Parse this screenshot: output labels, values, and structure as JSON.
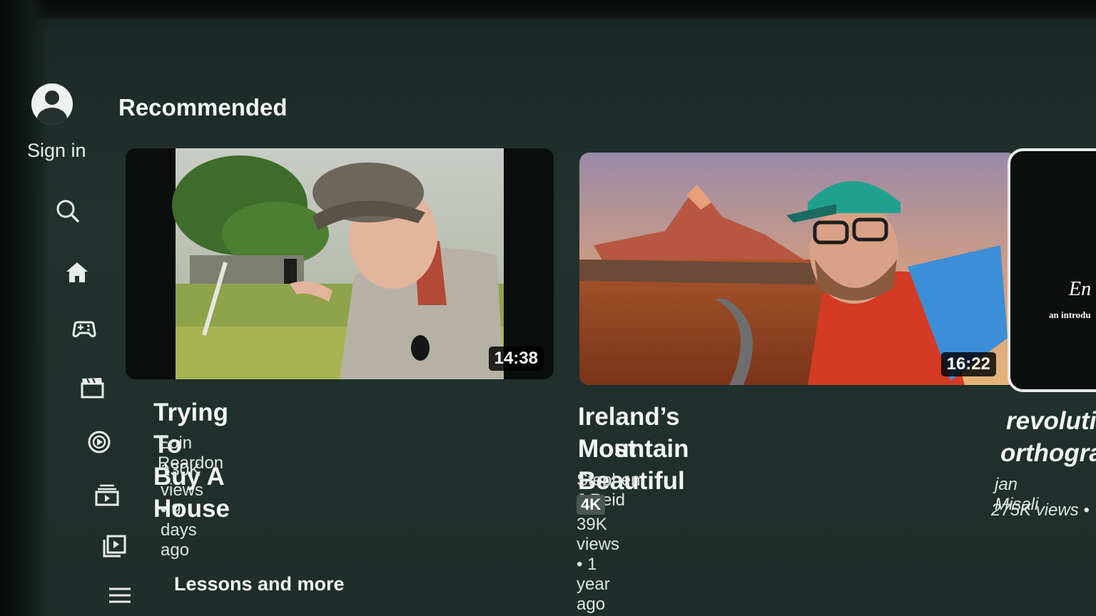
{
  "sidebar": {
    "sign_in_label": "Sign in",
    "icons": [
      "search-icon",
      "home-icon",
      "gaming-icon",
      "movies-icon",
      "music-icon",
      "subscriptions-icon",
      "library-icon",
      "menu-icon"
    ]
  },
  "sections": {
    "recommended_title": "Recommended",
    "lessons_title": "Lessons and more"
  },
  "videos": [
    {
      "title": "Trying To Buy A House",
      "channel": "Eoin Reardon",
      "meta": "130K views • 9 days ago",
      "duration": "14:38"
    },
    {
      "title_line1": "Ireland’s Most Beautiful",
      "title_line2": "Mountain",
      "channel": "Stephen J Reid",
      "badge": "4K",
      "meta": "39K views • 1 year ago",
      "duration": "16:22"
    },
    {
      "title_line1": "revoluti",
      "title_line2": "orthogra",
      "channel": "jan Misali",
      "meta": "275K views •",
      "thumb_text_1": "En",
      "thumb_text_2": "an introdu"
    }
  ],
  "colors": {
    "background": "#21312d",
    "text_primary": "#f2f4f3",
    "text_secondary": "#dfe3e1"
  }
}
